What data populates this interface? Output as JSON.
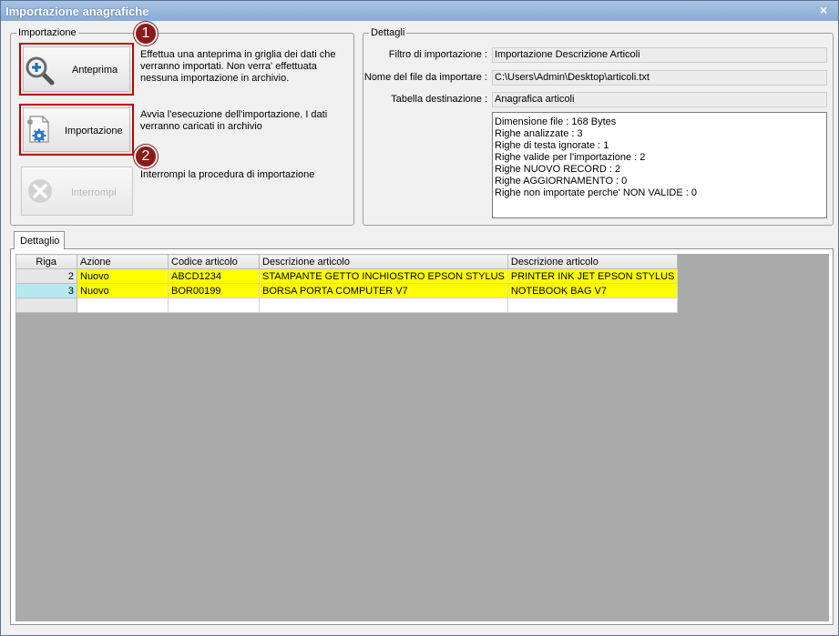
{
  "window": {
    "title": "Importazione anagrafiche",
    "close_glyph": "×"
  },
  "importazione": {
    "group_title": "Importazione",
    "anteprima": {
      "label": "Anteprima",
      "description": "Effettua una anteprima in griglia dei dati che verranno importati. Non verra' effettuata nessuna importazione in archivio."
    },
    "importa": {
      "label": "Importazione",
      "description": "Avvia l'esecuzione dell'importazione. I dati verranno caricati in archivio"
    },
    "interrompi": {
      "label": "Interrompi",
      "description": "Interrompi la procedura di importazione"
    },
    "badges": [
      "1",
      "2"
    ]
  },
  "dettagli": {
    "group_title": "Dettagli",
    "filtro_label": "Filtro di importazione :",
    "filtro_value": "Importazione Descrizione Articoli",
    "file_label": "Nome del file da importare :",
    "file_value": "C:\\Users\\Admin\\Desktop\\articoli.txt",
    "tabella_label": "Tabella destinazione :",
    "tabella_value": "Anagrafica articoli",
    "info_lines": [
      "Dimensione file : 168 Bytes",
      "Righe analizzate : 3",
      "Righe di testa ignorate : 1",
      "Righe valide per l'importazione : 2",
      "Righe NUOVO RECORD : 2",
      "Righe AGGIORNAMENTO  : 0",
      "Righe non importate perche' NON VALIDE : 0"
    ]
  },
  "tab": {
    "label": "Dettaglio"
  },
  "grid": {
    "columns": [
      "Riga",
      "Azione",
      "Codice articolo",
      "Descrizione articolo",
      "Descrizione articolo"
    ],
    "rows": [
      [
        "2",
        "Nuovo",
        "ABCD1234",
        "STAMPANTE GETTO INCHIOSTRO EPSON STYLUS",
        "PRINTER INK JET EPSON STYLUS"
      ],
      [
        "3",
        "Nuovo",
        "BOR00199",
        "BORSA PORTA COMPUTER V7",
        "NOTEBOOK BAG V7"
      ]
    ],
    "highlight_color": "#ffff00"
  }
}
